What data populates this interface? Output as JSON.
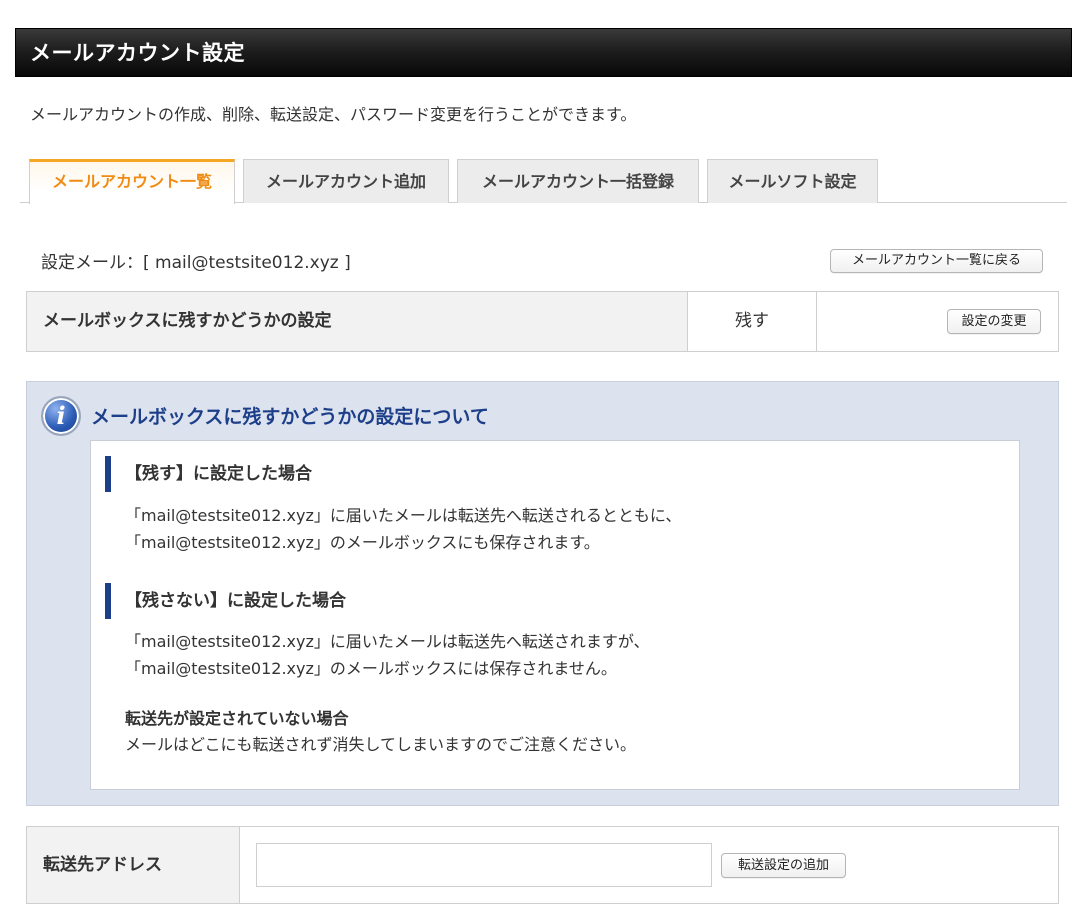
{
  "header": {
    "title": "メールアカウント設定"
  },
  "description": "メールアカウントの作成、削除、転送設定、パスワード変更を行うことができます。",
  "tabs": [
    {
      "label": "メールアカウント一覧",
      "active": true
    },
    {
      "label": "メールアカウント追加",
      "active": false
    },
    {
      "label": "メールアカウント一括登録",
      "active": false
    },
    {
      "label": "メールソフト設定",
      "active": false
    }
  ],
  "setting_mail": "設定メール：[ mail@testsite012.xyz ]",
  "back_button": "メールアカウント一覧に戻る",
  "mailbox_setting": {
    "label": "メールボックスに残すかどうかの設定",
    "value": "残す",
    "change_button": "設定の変更"
  },
  "info": {
    "title": "メールボックスに残すかどうかの設定について",
    "section1": {
      "heading": "【残す】に設定した場合",
      "line1": "「mail@testsite012.xyz」に届いたメールは転送先へ転送されるとともに、",
      "line2": "「mail@testsite012.xyz」のメールボックスにも保存されます。"
    },
    "section2": {
      "heading": "【残さない】に設定した場合",
      "line1": "「mail@testsite012.xyz」に届いたメールは転送先へ転送されますが、",
      "line2": "「mail@testsite012.xyz」のメールボックスには保存されません。"
    },
    "section3": {
      "heading": "転送先が設定されていない場合",
      "line1": "メールはどこにも転送されず消失してしまいますのでご注意ください。"
    }
  },
  "forward": {
    "label": "転送先アドレス",
    "input_value": "",
    "add_button": "転送設定の追加"
  },
  "colors": {
    "accent_orange": "#f08c14",
    "info_blue": "#1d3f8a",
    "info_bg": "#dce3ee"
  }
}
